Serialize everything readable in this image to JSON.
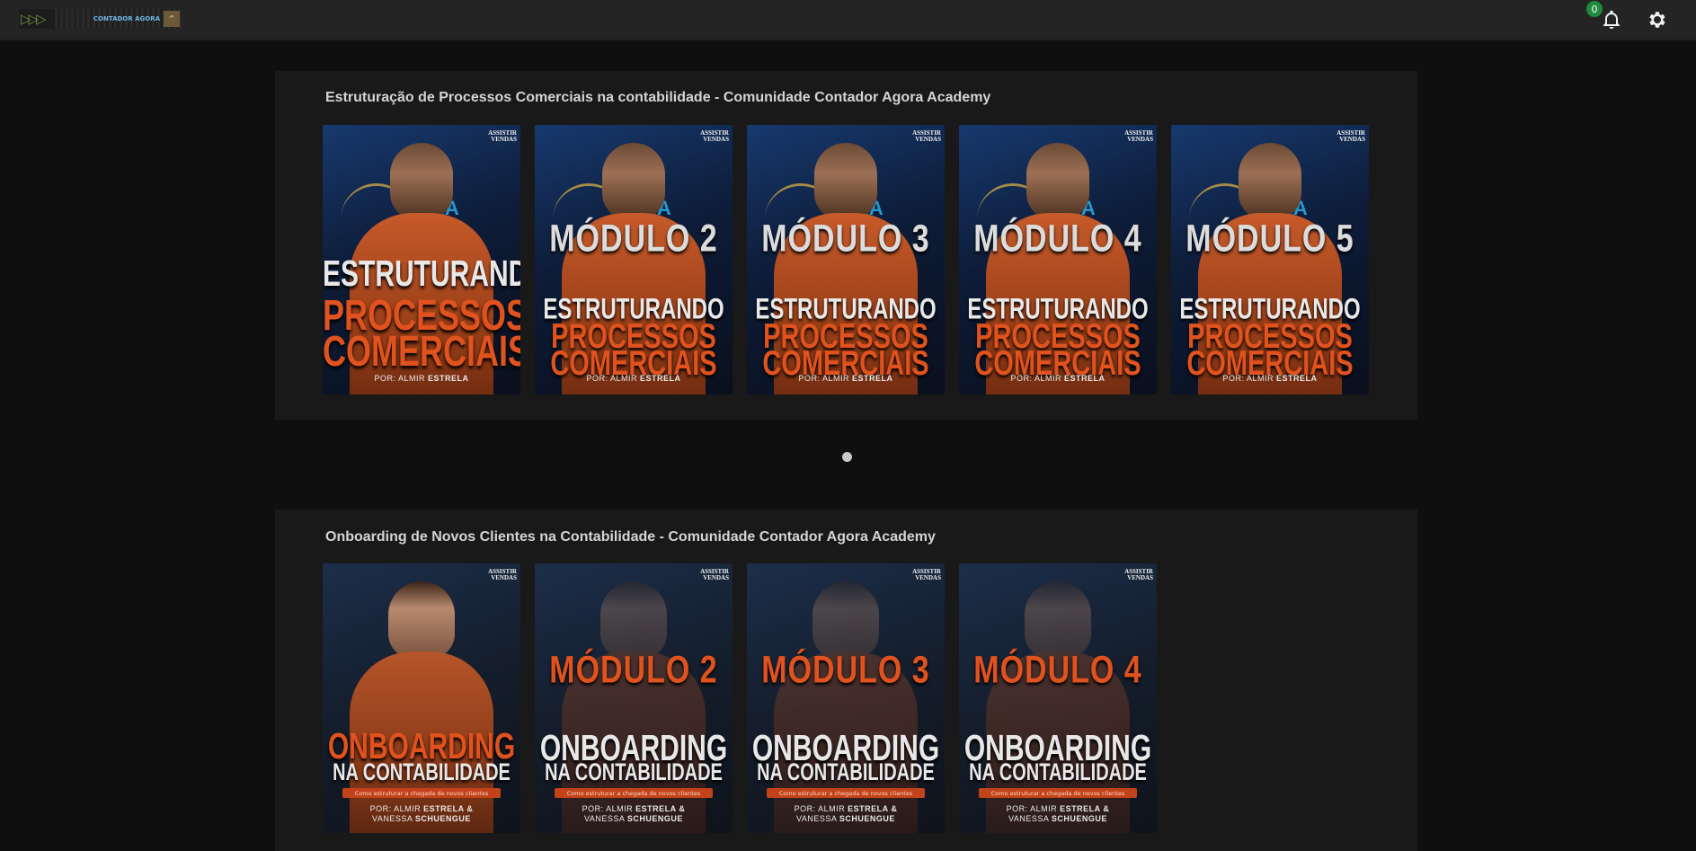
{
  "header": {
    "logo_brand": "CONTADOR AGORA",
    "notification_count": "0"
  },
  "sections": [
    {
      "title": "Estruturação de Processos Comerciais na contabilidade - Comunidade Contador Agora Academy",
      "cards": [
        {
          "corner": "ASSISTIR VENDAS",
          "module": "",
          "line1": "ESTRUTURANDO",
          "line2a": "PROCESSOS",
          "line2b": "COMERCIAIS",
          "author_prefix": "POR: ALMIR",
          "author_name": "ESTRELA"
        },
        {
          "corner": "ASSISTIR VENDAS",
          "module": "MÓDULO 2",
          "line1": "ESTRUTURANDO",
          "line2a": "PROCESSOS",
          "line2b": "COMERCIAIS",
          "author_prefix": "POR: ALMIR",
          "author_name": "ESTRELA"
        },
        {
          "corner": "ASSISTIR VENDAS",
          "module": "MÓDULO 3",
          "line1": "ESTRUTURANDO",
          "line2a": "PROCESSOS",
          "line2b": "COMERCIAIS",
          "author_prefix": "POR: ALMIR",
          "author_name": "ESTRELA"
        },
        {
          "corner": "ASSISTIR VENDAS",
          "module": "MÓDULO 4",
          "line1": "ESTRUTURANDO",
          "line2a": "PROCESSOS",
          "line2b": "COMERCIAIS",
          "author_prefix": "POR: ALMIR",
          "author_name": "ESTRELA"
        },
        {
          "corner": "ASSISTIR VENDAS",
          "module": "MÓDULO 5",
          "line1": "ESTRUTURANDO",
          "line2a": "PROCESSOS",
          "line2b": "COMERCIAIS",
          "author_prefix": "POR: ALMIR",
          "author_name": "ESTRELA"
        }
      ]
    },
    {
      "title": "Onboarding de Novos Clientes na Contabilidade - Comunidade Contador Agora Academy",
      "cards": [
        {
          "corner": "ASSISTIR VENDAS",
          "module": "",
          "line1": "ONBOARDING",
          "line2a": "NA CONTABILIDADE",
          "tagline": "Como estruturar a chegada de novos clientes",
          "author_prefix": "POR: ALMIR",
          "author_name": "ESTRELA &",
          "author2_name": "VANESSA",
          "author2_last": "SCHUENGUE"
        },
        {
          "corner": "ASSISTIR VENDAS",
          "module": "MÓDULO 2",
          "line1": "ONBOARDING",
          "line2a": "NA CONTABILIDADE",
          "tagline": "Como estruturar a chegada de novos clientes",
          "author_prefix": "POR: ALMIR",
          "author_name": "ESTRELA &",
          "author2_name": "VANESSA",
          "author2_last": "SCHUENGUE"
        },
        {
          "corner": "ASSISTIR VENDAS",
          "module": "MÓDULO 3",
          "line1": "ONBOARDING",
          "line2a": "NA CONTABILIDADE",
          "tagline": "Como estruturar a chegada de novos clientes",
          "author_prefix": "POR: ALMIR",
          "author_name": "ESTRELA &",
          "author2_name": "VANESSA",
          "author2_last": "SCHUENGUE"
        },
        {
          "corner": "ASSISTIR VENDAS",
          "module": "MÓDULO 4",
          "line1": "ONBOARDING",
          "line2a": "NA CONTABILIDADE",
          "tagline": "Como estruturar a chegada de novos clientes",
          "author_prefix": "POR: ALMIR",
          "author_name": "ESTRELA &",
          "author2_name": "VANESSA",
          "author2_last": "SCHUENGUE"
        }
      ]
    }
  ],
  "icons": {
    "logo": "chevrons-logo-icon",
    "bell": "bell-icon",
    "gear": "gear-icon"
  },
  "colors": {
    "accent": "#e0521e",
    "notification_badge": "#1f8b3d"
  }
}
